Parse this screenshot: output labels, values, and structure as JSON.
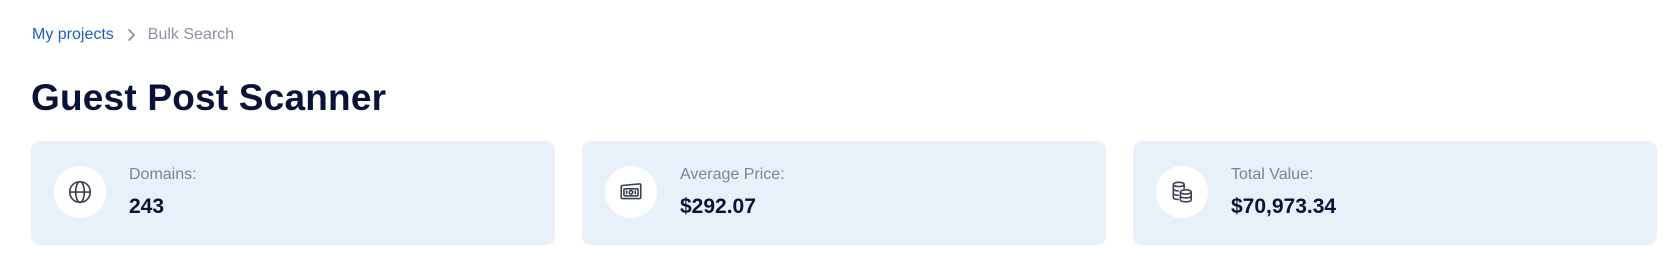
{
  "breadcrumb": {
    "parent": "My projects",
    "current": "Bulk Search",
    "separator_icon": "chevron-right-icon"
  },
  "page": {
    "title": "Guest Post Scanner"
  },
  "stats": [
    {
      "label": "Domains:",
      "value": "243",
      "icon": "globe-icon"
    },
    {
      "label": "Average Price:",
      "value": "$292.07",
      "icon": "banknote-icon"
    },
    {
      "label": "Total Value:",
      "value": "$70,973.34",
      "icon": "coins-icon"
    }
  ],
  "colors": {
    "link": "#1f5fbf",
    "card_bg": "#e8f0f9",
    "title": "#0b1237",
    "muted": "#7b8496"
  }
}
